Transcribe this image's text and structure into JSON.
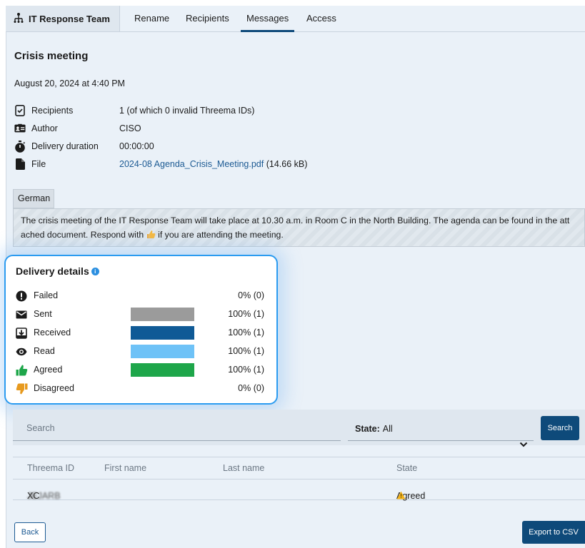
{
  "tabs": {
    "team": "IT Response Team",
    "items": [
      "Rename",
      "Recipients",
      "Messages",
      "Access"
    ],
    "active": "Messages"
  },
  "message": {
    "title": "Crisis meeting",
    "date": "August 20, 2024 at 4:40 PM",
    "meta": [
      {
        "icon": "phone-check-icon",
        "label": "Recipients",
        "value": "1 (of which 0 invalid Threema IDs)"
      },
      {
        "icon": "id-card-icon",
        "label": "Author",
        "value": "CISO"
      },
      {
        "icon": "stopwatch-icon",
        "label": "Delivery duration",
        "value": "00:00:00"
      },
      {
        "icon": "file-icon",
        "label": "File",
        "value": "2024-08 Agenda_Crisis_Meeting.pdf",
        "suffix": " (14.66 kB)"
      }
    ],
    "language": "German",
    "text_before_emoji": "The crisis meeting of the IT Response Team will take place at 10.30 a.m. in Room C in the North Building. The agenda can be found in the att",
    "text_line2_before": "ached document. Respond with ",
    "text_line2_after": " if you are attending the meeting."
  },
  "delivery": {
    "title": "Delivery details",
    "rows": [
      {
        "icon": "exclamation-icon",
        "label": "Failed",
        "fill": 0,
        "percent": "0% (0)",
        "color": "#9b9b9b"
      },
      {
        "icon": "envelope-icon",
        "label": "Sent",
        "fill": 1,
        "percent": "100% (1)",
        "color": "#9b9b9b"
      },
      {
        "icon": "inbox-download-icon",
        "label": "Received",
        "fill": 1,
        "percent": "100% (1)",
        "color": "#0f5a96"
      },
      {
        "icon": "eye-icon",
        "label": "Read",
        "fill": 1,
        "percent": "100% (1)",
        "color": "#6ec2f7"
      },
      {
        "icon": "thumbs-up-icon",
        "label": "Agreed",
        "fill": 1,
        "percent": "100% (1)",
        "color": "#1ea64a"
      },
      {
        "icon": "thumbs-down-icon",
        "label": "Disagreed",
        "fill": 0,
        "percent": "0% (0)",
        "color": "#e79a1f"
      }
    ]
  },
  "filter": {
    "search_placeholder": "Search",
    "state_label": "State:",
    "state_value": "All",
    "search_button": "Search"
  },
  "table": {
    "headers": [
      "Threema ID",
      "First name",
      "Last name",
      "State"
    ],
    "rows": [
      {
        "id": "XCJEJARB",
        "first": "",
        "last": "",
        "state": "Agreed"
      }
    ]
  },
  "buttons": {
    "back": "Back",
    "export": "Export to CSV"
  }
}
